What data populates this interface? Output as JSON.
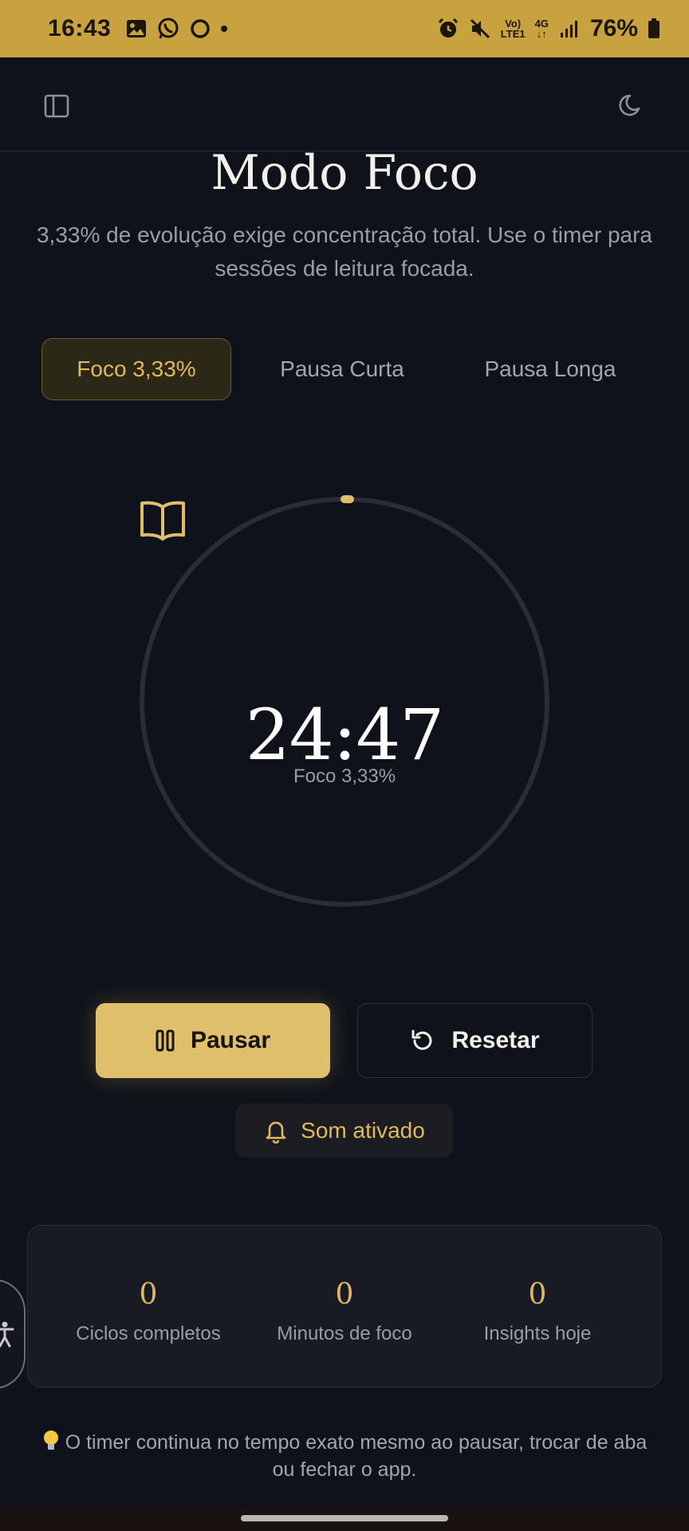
{
  "status_bar": {
    "time": "16:43",
    "network_top": "Vo)",
    "network_bottom": "LTE1",
    "signal_type": "4G",
    "battery": "76%",
    "icons": [
      "image-icon",
      "whatsapp-icon",
      "sync-icon",
      "alarm-icon",
      "mute-icon",
      "signal-icon",
      "battery-icon"
    ]
  },
  "app_bar": {
    "left_icon": "sidebar-icon",
    "right_icon": "moon-icon"
  },
  "header": {
    "title": "Modo Foco",
    "subtitle": "3,33% de evolução exige concentração total. Use o timer para sessões de leitura focada."
  },
  "tabs": [
    {
      "label": "Foco 3,33%",
      "active": true
    },
    {
      "label": "Pausa Curta",
      "active": false
    },
    {
      "label": "Pausa Longa",
      "active": false
    }
  ],
  "timer": {
    "icon": "book-icon",
    "time": "24:47",
    "mode_label": "Foco 3,33%",
    "progress": 0.0087
  },
  "controls": {
    "pause_label": "Pausar",
    "reset_label": "Resetar",
    "sound_label": "Som ativado"
  },
  "stats": [
    {
      "value": "0",
      "label": "Ciclos completos"
    },
    {
      "value": "0",
      "label": "Minutos de foco"
    },
    {
      "value": "0",
      "label": "Insights hoje"
    }
  ],
  "tip": {
    "icon": "lightbulb-icon",
    "text": "O timer continua no tempo exato mesmo ao pausar, trocar de aba ou fechar o app."
  },
  "colors": {
    "accent": "#e0bf6c",
    "status_bar": "#c9a240",
    "background": "#10121b"
  }
}
